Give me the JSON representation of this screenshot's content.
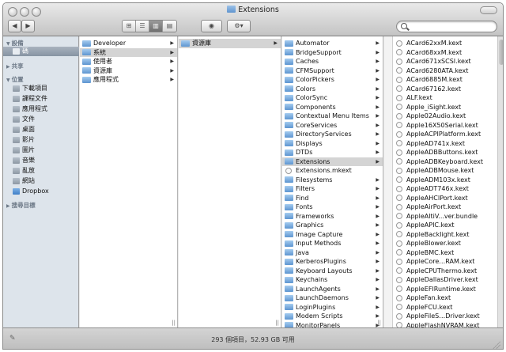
{
  "window": {
    "title": "Extensions"
  },
  "toolbar": {
    "back_label": "◀",
    "forward_label": "▶",
    "views": [
      "⊞",
      "☰",
      "▥",
      "▤"
    ],
    "eye_label": "◉",
    "action_label": "⚙▾",
    "search_placeholder": ""
  },
  "sidebar": {
    "devices_header": "設備",
    "device_item": "碼",
    "shared_header": "共享",
    "places_header": "位置",
    "places": [
      "下載項目",
      "課程文件",
      "應用程式",
      "文件",
      "桌面",
      "影片",
      "圖片",
      "音樂",
      "亂放",
      "網站",
      "Dropbox"
    ],
    "search_header": "搜尋目標"
  },
  "columns": {
    "col1": [
      "Developer",
      "系統",
      "使用者",
      "資源庫",
      "應用程式"
    ],
    "col2": [
      "資源庫"
    ],
    "col3": [
      "Automator",
      "BridgeSupport",
      "Caches",
      "CFMSupport",
      "ColorPickers",
      "Colors",
      "ColorSync",
      "Components",
      "Contextual Menu Items",
      "CoreServices",
      "DirectoryServices",
      "Displays",
      "DTDs",
      "Extensions",
      "Extensions.mkext",
      "Filesystems",
      "Filters",
      "Find",
      "Fonts",
      "Frameworks",
      "Graphics",
      "Image Capture",
      "Input Methods",
      "Java",
      "KerberosPlugins",
      "Keyboard Layouts",
      "Keychains",
      "LaunchAgents",
      "LaunchDaemons",
      "LoginPlugins",
      "Modem Scripts",
      "MonitorPanels"
    ],
    "col4": [
      "ACard62xxM.kext",
      "ACard68xxM.kext",
      "ACard671xSCSI.kext",
      "ACard6280ATA.kext",
      "ACard6885M.kext",
      "ACard67162.kext",
      "ALF.kext",
      "Apple_iSight.kext",
      "Apple02Audio.kext",
      "Apple16X50Serial.kext",
      "AppleACPIPlatform.kext",
      "AppleAD741x.kext",
      "AppleADBButtons.kext",
      "AppleADBKeyboard.kext",
      "AppleADBMouse.kext",
      "AppleADM103x.kext",
      "AppleADT746x.kext",
      "AppleAHCIPort.kext",
      "AppleAirPort.kext",
      "AppleAltiV...ver.bundle",
      "AppleAPIC.kext",
      "AppleBacklight.kext",
      "AppleBlower.kext",
      "AppleBMC.kext",
      "AppleCore…RAM.kext",
      "AppleCPUThermo.kext",
      "AppleDallasDriver.kext",
      "AppleEFIRuntime.kext",
      "AppleFan.kext",
      "AppleFCU.kext",
      "AppleFileS…Driver.kext",
      "AppleFlashNVRAM.kext"
    ]
  },
  "status": {
    "text": "293 個項目，52.93 GB 可用"
  }
}
